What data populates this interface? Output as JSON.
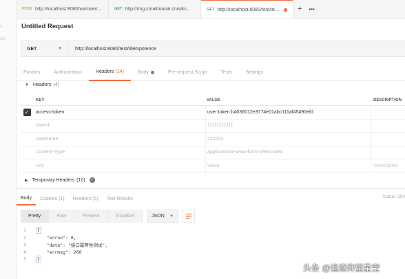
{
  "sidebar": {
    "ghost_lines": [
      "s",
      "ath"
    ]
  },
  "tabs": [
    {
      "method": "POST",
      "url": "http://localhost:8080/wx/user/...",
      "method_color": "#d9a53b"
    },
    {
      "method": "GET",
      "url": "http://img.smallmarial.cn/wks...",
      "method_color": "#3e9f5a"
    },
    {
      "method": "GET",
      "url": "http://localhost:8080/test/ide...",
      "method_color": "#3e9f5a",
      "active": true,
      "unsaved": true
    }
  ],
  "tab_actions": {
    "add": "+",
    "more": "•••"
  },
  "request": {
    "title": "Untitled Request",
    "method": "GET",
    "url": "http://localhost:8080/test/idempotence"
  },
  "request_tabs": {
    "params": "Params",
    "authorization": "Authorization",
    "headers": "Headers",
    "headers_count": "(14)",
    "body": "Body",
    "prerequest": "Pre-request Script",
    "tests": "Tests",
    "settings": "Settings"
  },
  "headers_section": {
    "label": "Headers",
    "count": "(4)",
    "columns": {
      "key": "KEY",
      "value": "VALUE",
      "description": "DESCRIPTION"
    },
    "rows": [
      {
        "checked": true,
        "key": "access-token",
        "value": "user:token:b4036012e3774e01abc111af45490efd",
        "description": ""
      },
      {
        "checked": false,
        "key": "userId",
        "value": "11111111111",
        "description": ""
      },
      {
        "checked": false,
        "key": "userName",
        "value": "222222",
        "description": ""
      },
      {
        "checked": false,
        "key": "Content-Type",
        "value": "application/x-www-form-urlencoded",
        "description": ""
      }
    ],
    "placeholder_row": {
      "key": "Key",
      "value": "Value",
      "description": "Description"
    }
  },
  "temporary_headers": {
    "label": "Temporary Headers",
    "count": "(10)"
  },
  "response_tabs": {
    "body": "Body",
    "cookies": "Cookies (1)",
    "headers": "Headers (5)",
    "test_results": "Test Results",
    "status": "Status: 200"
  },
  "response_toolbar": {
    "pretty": "Pretty",
    "raw": "Raw",
    "preview": "Preview",
    "visualize": "Visualize",
    "format": "JSON"
  },
  "response_body": [
    {
      "n": "1",
      "text": "{"
    },
    {
      "n": "2",
      "text": "    \"errno\": 0,"
    },
    {
      "n": "3",
      "text": "    \"data\": \"接口幂等性测试\","
    },
    {
      "n": "4",
      "text": "    \"errmsg\": 200"
    },
    {
      "n": "5",
      "text": "}"
    }
  ],
  "watermark": "头条 @追逐仰望星空",
  "colors": {
    "accent": "#f26b3a",
    "get_green": "#3e9f5a",
    "post_yellow": "#d9a53b"
  }
}
